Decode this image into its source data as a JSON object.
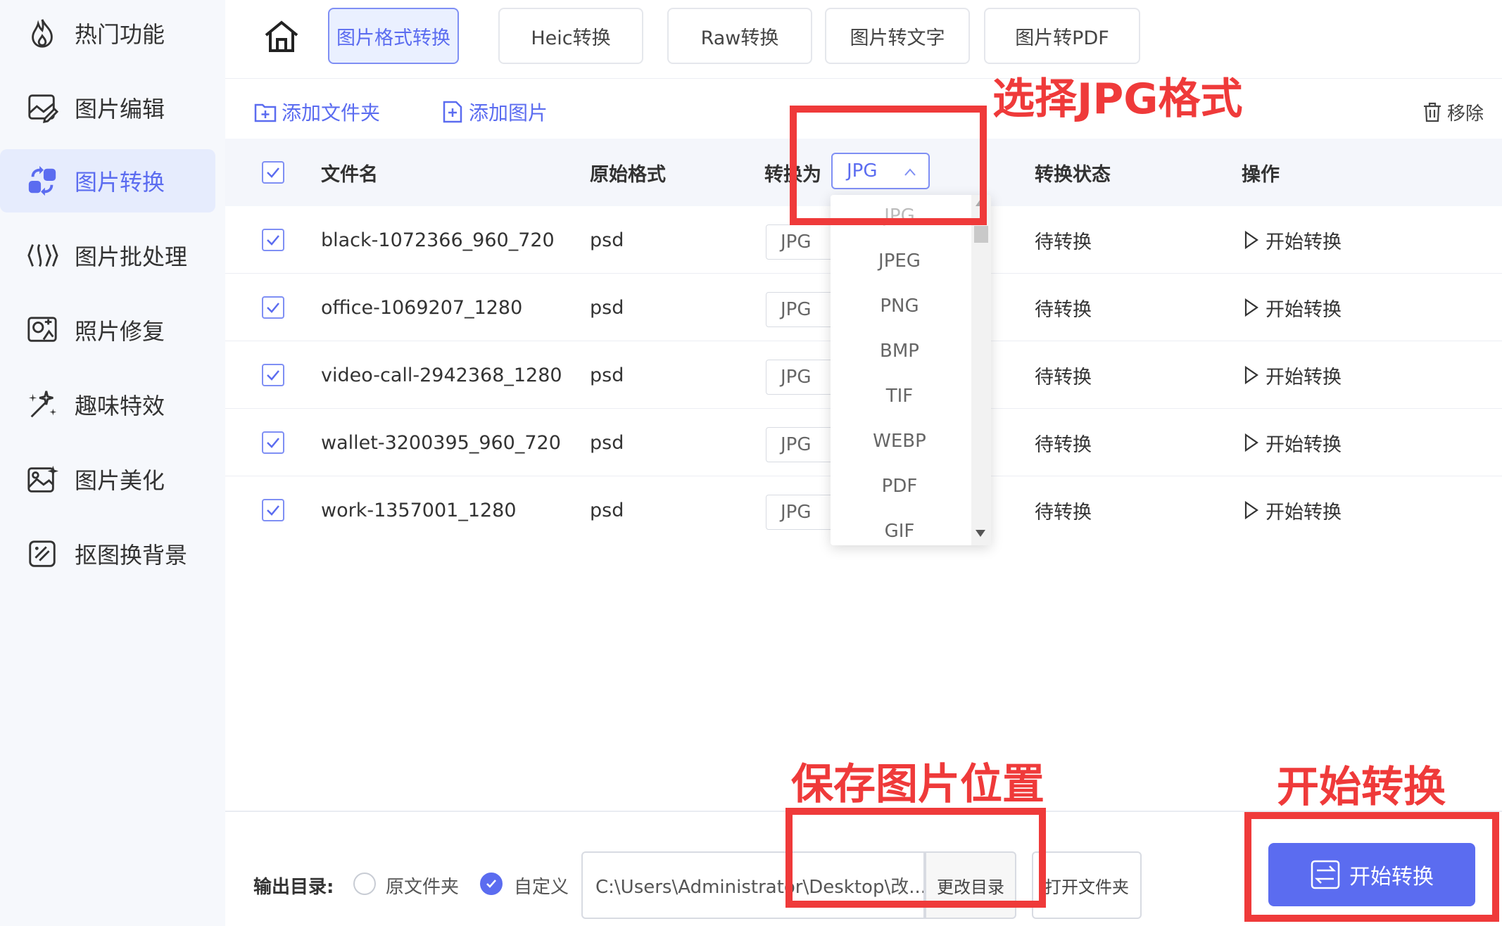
{
  "sidebar": {
    "items": [
      {
        "label": "热门功能",
        "icon": "flame-icon"
      },
      {
        "label": "图片编辑",
        "icon": "image-edit-icon"
      },
      {
        "label": "图片转换",
        "icon": "convert-icon"
      },
      {
        "label": "图片批处理",
        "icon": "batch-icon"
      },
      {
        "label": "照片修复",
        "icon": "photo-repair-icon"
      },
      {
        "label": "趣味特效",
        "icon": "sparkle-icon"
      },
      {
        "label": "图片美化",
        "icon": "beautify-icon"
      },
      {
        "label": "抠图换背景",
        "icon": "cutout-icon"
      }
    ],
    "active_index": 2
  },
  "tabs": [
    {
      "label": "图片格式转换"
    },
    {
      "label": "Heic转换"
    },
    {
      "label": "Raw转换"
    },
    {
      "label": "图片转文字"
    },
    {
      "label": "图片转PDF"
    }
  ],
  "toolbar": {
    "add_folder": "添加文件夹",
    "add_image": "添加图片",
    "remove": "移除"
  },
  "table": {
    "headers": {
      "filename": "文件名",
      "orig_format": "原始格式",
      "convert_to": "转换为",
      "status": "转换状态",
      "action": "操作"
    },
    "header_select_value": "JPG",
    "rows": [
      {
        "name": "black-1072366_960_720",
        "format": "psd",
        "target": "JPG",
        "status": "待转换",
        "action": "开始转换"
      },
      {
        "name": "office-1069207_1280",
        "format": "psd",
        "target": "JPG",
        "status": "待转换",
        "action": "开始转换"
      },
      {
        "name": "video-call-2942368_1280",
        "format": "psd",
        "target": "JPG",
        "status": "待转换",
        "action": "开始转换"
      },
      {
        "name": "wallet-3200395_960_720",
        "format": "psd",
        "target": "JPG",
        "status": "待转换",
        "action": "开始转换"
      },
      {
        "name": "work-1357001_1280",
        "format": "psd",
        "target": "JPG",
        "status": "待转换",
        "action": "开始转换"
      }
    ]
  },
  "dropdown": {
    "options": [
      "JPG",
      "JPEG",
      "PNG",
      "BMP",
      "TIF",
      "WEBP",
      "PDF",
      "GIF"
    ]
  },
  "footer": {
    "output_label": "输出目录:",
    "radio_original": "原文件夹",
    "radio_custom": "自定义",
    "path": "C:\\Users\\Administrator\\Desktop\\改...",
    "change_dir": "更改目录",
    "open_folder": "打开文件夹",
    "start": "开始转换"
  },
  "annotations": {
    "select_jpg": "选择JPG格式",
    "save_location": "保存图片位置",
    "start_convert": "开始转换"
  },
  "colors": {
    "accent": "#5b6cf0",
    "annotation_red": "#ef3a3a",
    "sidebar_bg": "#f6f8fc"
  }
}
